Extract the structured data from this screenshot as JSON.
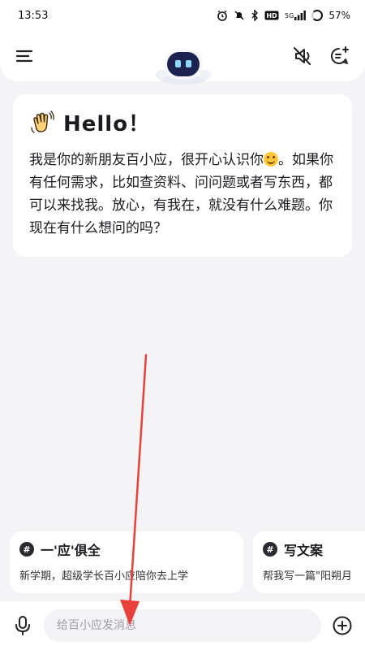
{
  "status_bar": {
    "time": "13:53",
    "network": "5G",
    "battery": "57%"
  },
  "header": {
    "menu_icon": "menu-icon",
    "mute_icon": "speaker-off-icon",
    "new_chat_icon": "new-chat-icon"
  },
  "greeting": {
    "title": "Hello！",
    "text_part1": "我是你的新朋友百小应，很开心认识你",
    "text_part2": "。如果你有任何需求，比如查资料、问问题或者写东西，都可以来找我。放心，有我在，就没有什么难题。你现在有什么想问的吗？"
  },
  "suggestions": [
    {
      "title": "一'应'俱全",
      "desc": "新学期，超级学长百小应陪你去上学"
    },
    {
      "title": "写文案",
      "desc": "帮我写一篇\"阳朔月"
    }
  ],
  "input": {
    "placeholder": "给百小应发消息"
  },
  "colors": {
    "background": "#f4f4f6",
    "card": "#ffffff",
    "annotation_arrow": "#e8413c"
  }
}
